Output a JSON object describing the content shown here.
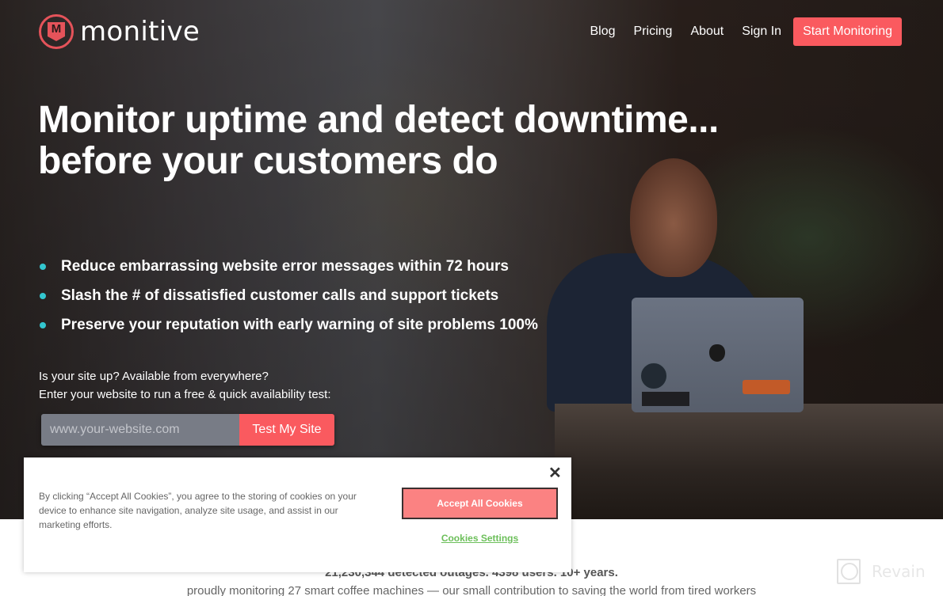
{
  "brand": {
    "name": "monitive",
    "logo_letter": "M",
    "accent_color": "#fa5a5f"
  },
  "nav": {
    "links": [
      "Blog",
      "Pricing",
      "About",
      "Sign In"
    ],
    "cta": "Start Monitoring"
  },
  "hero": {
    "headline_line1": "Monitor uptime and detect downtime...",
    "headline_line2": "before your customers do",
    "bullets": [
      "Reduce embarrassing website error messages within 72 hours",
      "Slash the # of dissatisfied customer calls and support tickets",
      "Preserve your reputation with early warning of site problems 100%"
    ],
    "bullet_color": "#33c6cf",
    "test_prompt_line1": "Is your site up? Available from everywhere?",
    "test_prompt_line2": "Enter your website to run a free & quick availability test:",
    "test_input_placeholder": "www.your-website.com",
    "test_button": "Test My Site"
  },
  "stats": {
    "main": "21,230,344 detected outages. 4398 users. 10+ years.",
    "sub": "proudly monitoring 27 smart coffee machines — our small contribution to saving the world from tired workers"
  },
  "cookie_banner": {
    "text": "By clicking “Accept All Cookies”, you agree to the storing of cookies on your device to enhance site navigation, analyze site usage, and assist in our marketing efforts.",
    "accept_label": "Accept All Cookies",
    "settings_label": "Cookies Settings",
    "close_glyph": "✕"
  },
  "watermark": {
    "text": "Revain"
  }
}
